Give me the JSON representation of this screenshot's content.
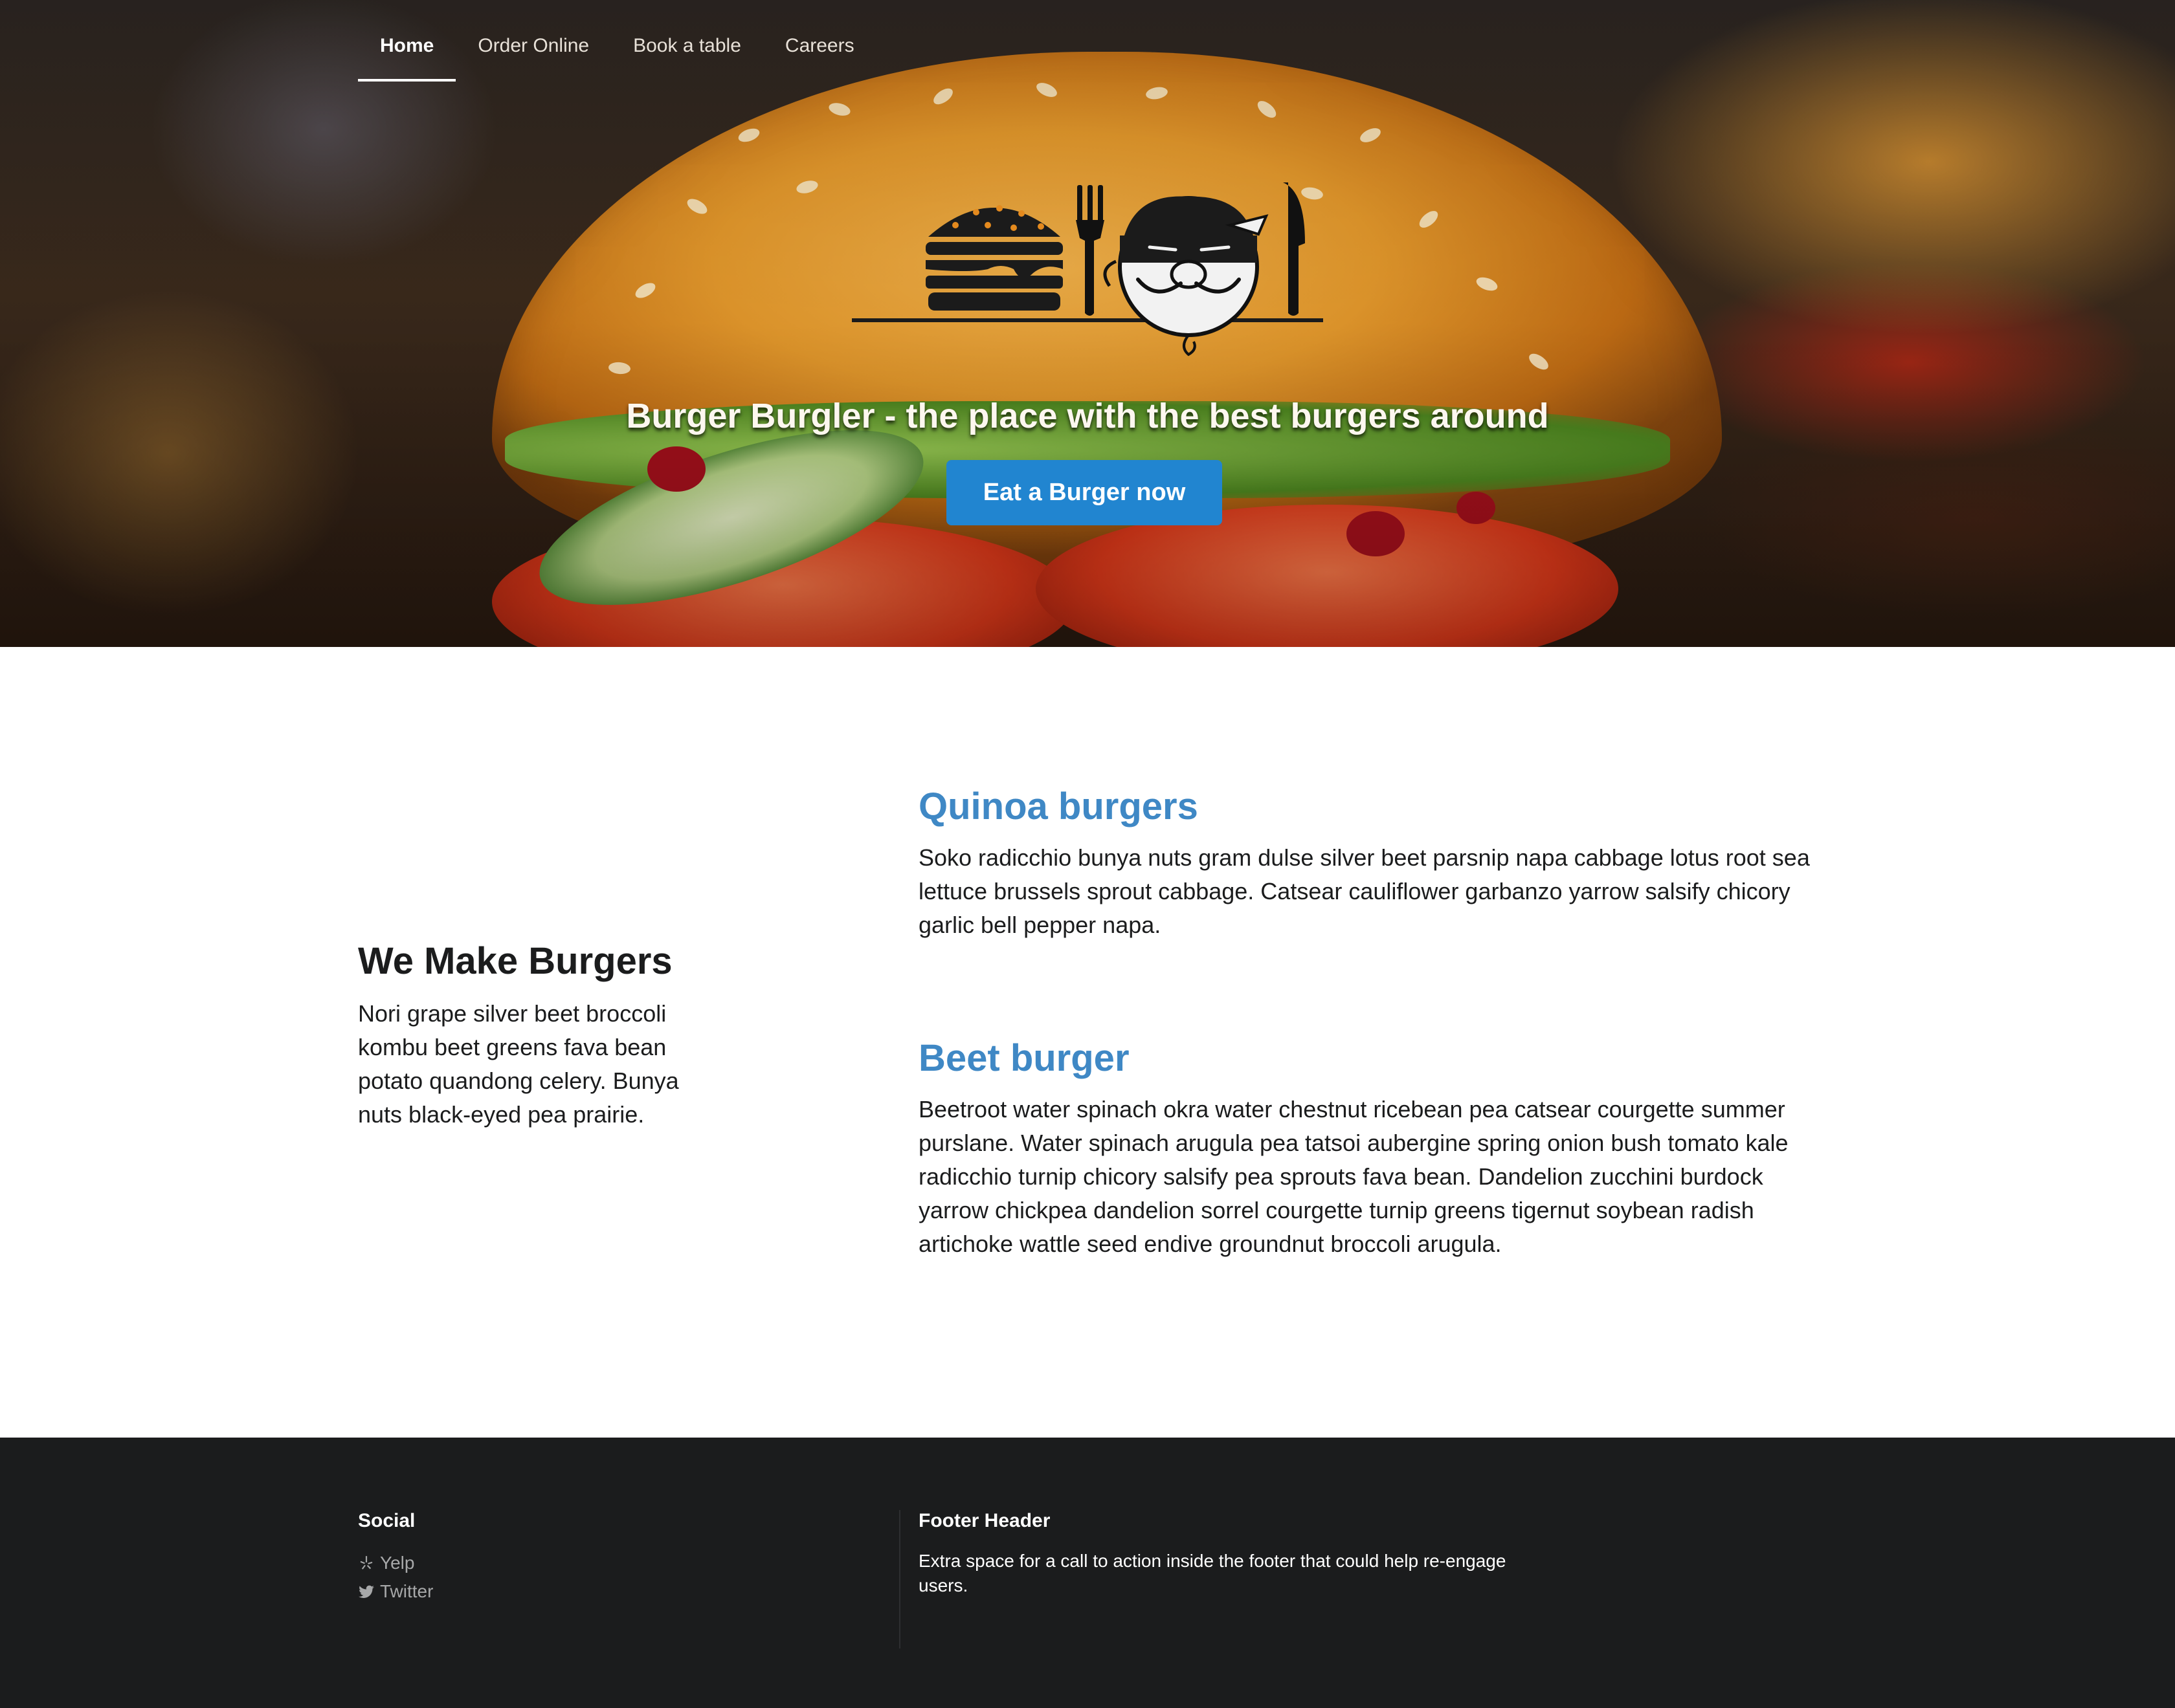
{
  "nav": {
    "items": [
      {
        "label": "Home",
        "active": true
      },
      {
        "label": "Order Online",
        "active": false
      },
      {
        "label": "Book a table",
        "active": false
      },
      {
        "label": "Careers",
        "active": false
      }
    ]
  },
  "hero": {
    "logo_icons": [
      "burger-icon",
      "fork-icon",
      "burglar-mascot-icon",
      "knife-icon"
    ],
    "tagline": "Burger Burgler - the place with the best burgers around",
    "cta_label": "Eat a Burger now",
    "cta_color": "#2185d0"
  },
  "intro": {
    "title": "We Make Burgers",
    "text": "Nori grape silver beet broccoli kombu beet greens fava bean potato quandong celery. Bunya nuts black-eyed pea prairie."
  },
  "items": [
    {
      "title": "Quinoa burgers",
      "text": "Soko radicchio bunya nuts gram dulse silver beet parsnip napa cabbage lotus root sea lettuce brussels sprout cabbage. Catsear cauliflower garbanzo yarrow salsify chicory garlic bell pepper napa."
    },
    {
      "title": "Beet burger",
      "text": "Beetroot water spinach okra water chestnut ricebean pea catsear courgette summer purslane. Water spinach arugula pea tatsoi aubergine spring onion bush tomato kale radicchio turnip chicory salsify pea sprouts fava bean. Dandelion zucchini burdock yarrow chickpea dandelion sorrel courgette turnip greens tigernut soybean radish artichoke wattle seed endive groundnut broccoli arugula."
    }
  ],
  "footer": {
    "social": {
      "header": "Social",
      "links": [
        {
          "label": "Yelp",
          "icon": "yelp-icon"
        },
        {
          "label": "Twitter",
          "icon": "twitter-icon"
        }
      ]
    },
    "cta": {
      "header": "Footer Header",
      "text": "Extra space for a call to action inside the footer that could help re-engage users."
    },
    "background": "#1b1c1d"
  },
  "colors": {
    "heading_accent": "#3f88c5",
    "primary_button": "#2185d0"
  }
}
